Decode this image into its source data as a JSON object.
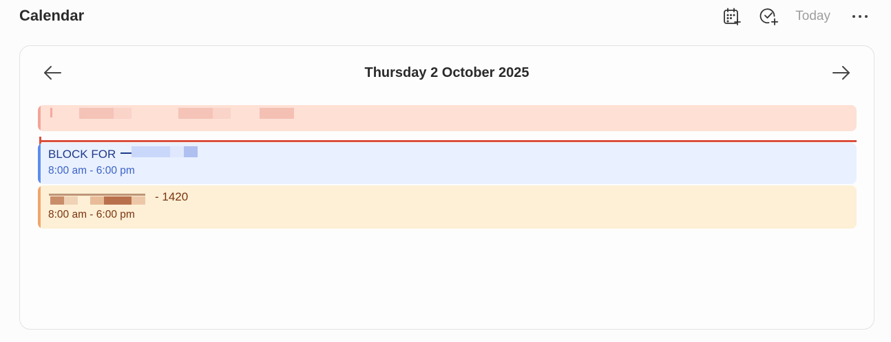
{
  "header": {
    "title": "Calendar",
    "today_label": "Today",
    "icons": [
      "calendar-add-icon",
      "task-add-icon",
      "more-horizontal-icon"
    ]
  },
  "day_view": {
    "date_heading": "Thursday 2 October 2025",
    "events": [
      {
        "title": "",
        "time": "",
        "kind": "all-day",
        "color": "#fee0d5",
        "accent": "#f3a598"
      },
      {
        "title": "BLOCK FOR",
        "time": "8:00 am - 6:00 pm",
        "color": "#e9f0ff",
        "accent": "#5b8def"
      },
      {
        "title": "- 1420",
        "time": "8:00 am - 6:00 pm",
        "color": "#fdf0d6",
        "accent": "#f1a56b"
      }
    ],
    "current_time_color": "#d94f3c"
  }
}
